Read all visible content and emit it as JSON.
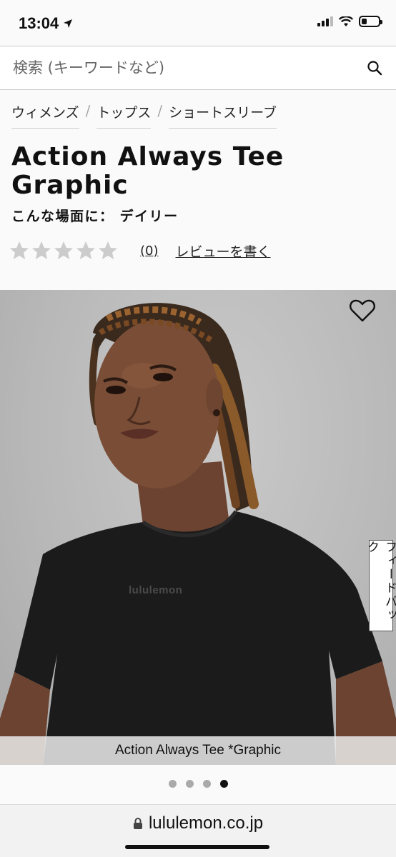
{
  "status_bar": {
    "time": "13:04",
    "battery_level": 0.3
  },
  "search": {
    "placeholder": "検索 (キーワードなど)"
  },
  "breadcrumb": [
    {
      "label": "ウィメンズ"
    },
    {
      "label": "トップス"
    },
    {
      "label": "ショートスリーブ"
    }
  ],
  "breadcrumb_separator": "/",
  "product": {
    "title": "Action Always Tee Graphic",
    "occasion": "こんな場面に： デイリー",
    "rating": 0,
    "rating_max": 5,
    "review_count": "(0)",
    "write_review_label": "レビューを書く"
  },
  "image": {
    "tee_logo": "lululemon",
    "caption": "Action Always Tee *Graphic",
    "carousel_total": 4,
    "carousel_active": 4
  },
  "feedback_tab": {
    "label": "フィードバック"
  },
  "browser": {
    "url": "lululemon.co.jp"
  },
  "colors": {
    "star_empty": "#cccccc",
    "dot_inactive": "#aaaaaa",
    "dot_active": "#111111"
  }
}
